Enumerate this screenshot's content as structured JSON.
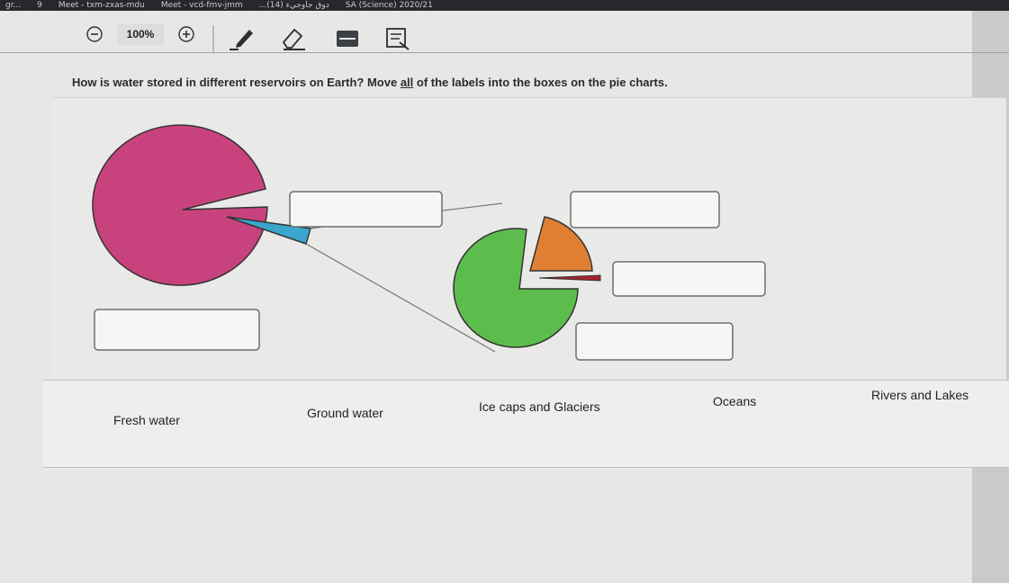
{
  "browser": {
    "tabs": [
      "gr...",
      "9",
      "Meet - txm-zxas-mdu",
      "Meet - vcd-fmv-jmm",
      "...دوق جاوجيء (14)",
      "SA (Science) 2020/21"
    ]
  },
  "toolbar": {
    "zoom_value": "100%"
  },
  "question": {
    "text_before": "How is water stored in different reservoirs on Earth? Move ",
    "emphasis": "all",
    "text_after": " of the labels into the boxes on the pie charts."
  },
  "pie_big": {
    "colors": {
      "main": "#c8437e",
      "slice": "#3aa6cc"
    }
  },
  "pie_small": {
    "colors": {
      "large": "#5cbd4d",
      "medium": "#e07f33",
      "thin": "#a5242c"
    }
  },
  "labels": [
    "Fresh water",
    "Ground water",
    "Ice caps and Glaciers",
    "Oceans",
    "Rivers and Lakes"
  ]
}
